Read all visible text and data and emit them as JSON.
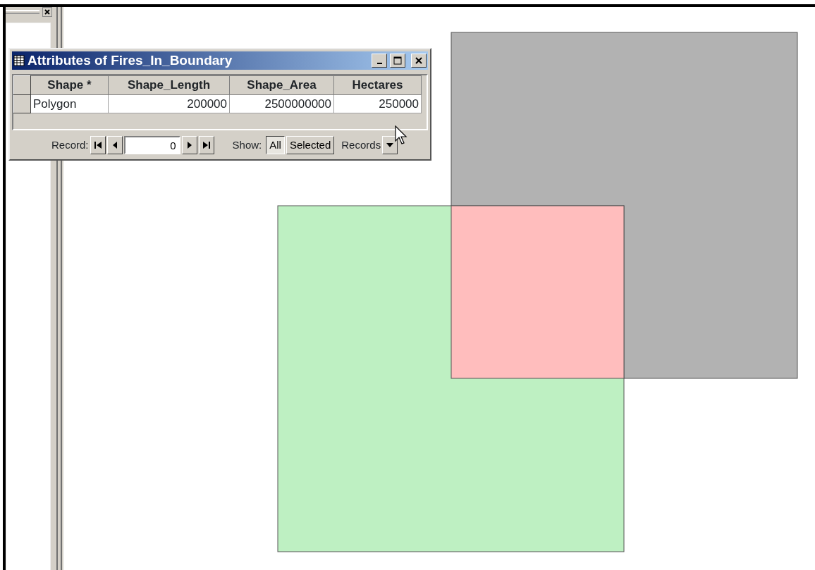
{
  "attributes_window": {
    "title": "Attributes of Fires_In_Boundary",
    "columns": [
      "Shape *",
      "Shape_Length",
      "Shape_Area",
      "Hectares"
    ],
    "rows": [
      {
        "selected": false,
        "cells": [
          "Polygon",
          "200000",
          "2500000000",
          "250000"
        ]
      }
    ],
    "record_label": "Record:",
    "record_value": "0",
    "show_label": "Show:",
    "show_options": [
      {
        "label": "All",
        "selected": true
      },
      {
        "label": "Selected",
        "selected": false
      }
    ],
    "records_menu": "Records"
  },
  "map": {
    "polygons": [
      {
        "color": "#b2b2b2"
      },
      {
        "color": "#bef0c2"
      },
      {
        "color": "#ffbdbd"
      }
    ]
  }
}
